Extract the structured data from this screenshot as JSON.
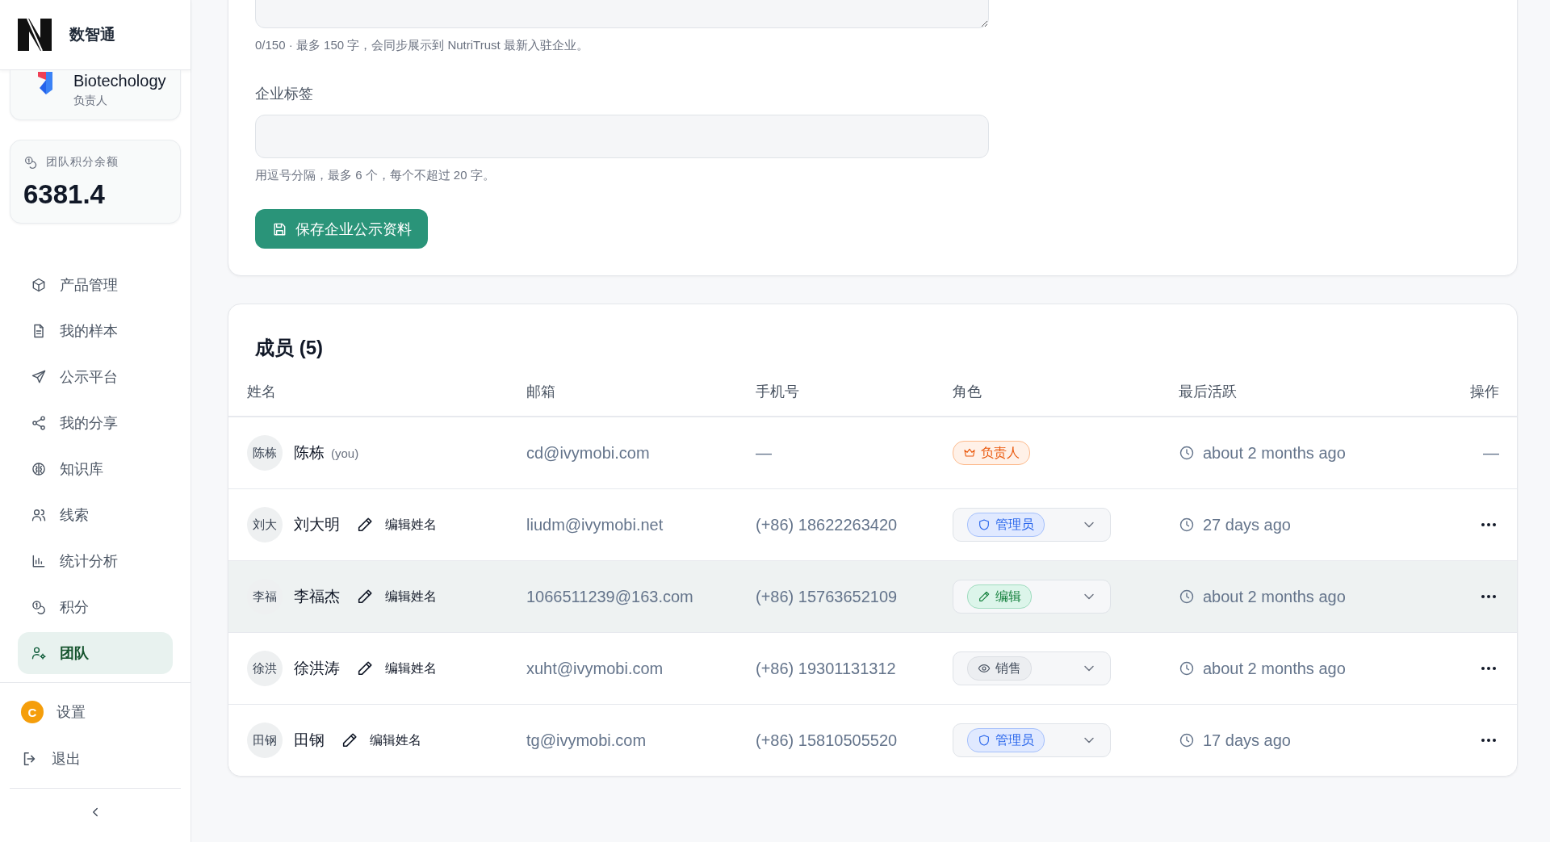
{
  "sidebar": {
    "brand": "数智通",
    "org": {
      "name": "Biotechology",
      "role": "负责人"
    },
    "credits": {
      "label": "团队积分余额",
      "value": "6381.4"
    },
    "nav": [
      {
        "label": "产品管理",
        "selected": false
      },
      {
        "label": "我的样本",
        "selected": false
      },
      {
        "label": "公示平台",
        "selected": false
      },
      {
        "label": "我的分享",
        "selected": false
      },
      {
        "label": "知识库",
        "selected": false
      },
      {
        "label": "线索",
        "selected": false
      },
      {
        "label": "统计分析",
        "selected": false
      },
      {
        "label": "积分",
        "selected": false
      },
      {
        "label": "团队",
        "selected": true
      }
    ],
    "footer": [
      {
        "kind": "avatar",
        "avatar": "C",
        "label": "设置"
      },
      {
        "kind": "logout",
        "label": "退出"
      }
    ]
  },
  "profile_form": {
    "description_hint": "0/150 · 最多 150 字，会同步展示到 NutriTrust 最新入驻企业。",
    "tags_label": "企业标签",
    "tags_hint": "用逗号分隔，最多 6 个，每个不超过 20 字。",
    "save_button": "保存企业公示资料"
  },
  "members": {
    "title": "成员 (5)",
    "columns": [
      "姓名",
      "邮箱",
      "手机号",
      "角色",
      "最后活跃",
      "操作"
    ],
    "rows": [
      {
        "avatar": "陈栋",
        "name": "陈栋",
        "you": "(you)",
        "email": "cd@ivymobi.com",
        "phone": "—",
        "role": {
          "kind": "owner",
          "label": "负责人",
          "dropdown": false
        },
        "last_active": "about 2 months ago",
        "action": "—",
        "selected": false
      },
      {
        "avatar": "刘大",
        "name": "刘大明",
        "edit": "编辑姓名",
        "email": "liudm@ivymobi.net",
        "phone": "(+86) 18622263420",
        "role": {
          "kind": "admin",
          "label": "管理员",
          "dropdown": true
        },
        "last_active": "27 days ago",
        "menu": true,
        "selected": false
      },
      {
        "avatar": "李福",
        "name": "李福杰",
        "edit": "编辑姓名",
        "email": "1066511239@163.com",
        "phone": "(+86) 15763652109",
        "role": {
          "kind": "editor",
          "label": "编辑",
          "dropdown": true
        },
        "last_active": "about 2 months ago",
        "menu": true,
        "selected": true
      },
      {
        "avatar": "徐洪",
        "name": "徐洪涛",
        "edit": "编辑姓名",
        "email": "xuht@ivymobi.com",
        "phone": "(+86) 19301131312",
        "role": {
          "kind": "sales",
          "label": "销售",
          "dropdown": true
        },
        "last_active": "about 2 months ago",
        "menu": true,
        "selected": false
      },
      {
        "avatar": "田钢",
        "name": "田钢",
        "edit": "编辑姓名",
        "email": "tg@ivymobi.com",
        "phone": "(+86) 15810505520",
        "role": {
          "kind": "admin",
          "label": "管理员",
          "dropdown": true
        },
        "last_active": "17 days ago",
        "menu": true,
        "selected": false
      }
    ]
  }
}
